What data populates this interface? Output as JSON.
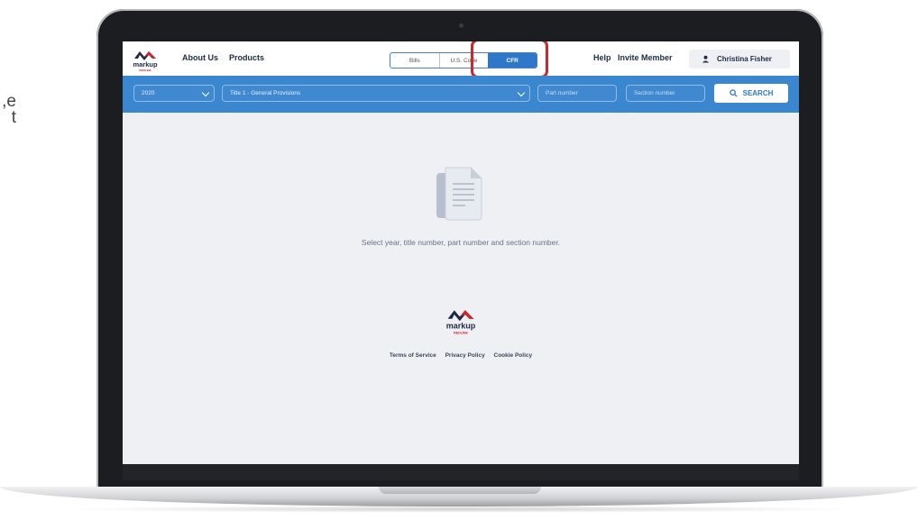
{
  "side_text": {
    "line1": "e,",
    "line2": "t"
  },
  "header": {
    "logo": {
      "word": "markup",
      "sub": "REDLINE"
    },
    "nav": [
      {
        "label": "About Us"
      },
      {
        "label": "Products"
      }
    ],
    "source_tabs": [
      {
        "label": "Bills"
      },
      {
        "label": "U.S. Code"
      },
      {
        "label": "CFR",
        "active": true
      }
    ],
    "help_label": "Help",
    "invite_label": "Invite Member",
    "user_name": "Christina Fisher"
  },
  "search": {
    "year": "2020",
    "title": "Title 1 - General Provisions",
    "part_placeholder": "Part number",
    "section_placeholder": "Section number",
    "button_label": "SEARCH"
  },
  "main": {
    "empty_message": "Select year, title number, part number and section number."
  },
  "footer": {
    "links": [
      {
        "label": "Terms of Service"
      },
      {
        "label": "Privacy Policy"
      },
      {
        "label": "Cookie Policy"
      }
    ]
  },
  "colors": {
    "accent": "#3a86cf",
    "brand_red": "#d0242c",
    "brand_navy": "#1e2a44"
  },
  "icons": [
    "markup-logo",
    "user-icon",
    "chevron-down-icon",
    "search-icon",
    "document-icon"
  ]
}
